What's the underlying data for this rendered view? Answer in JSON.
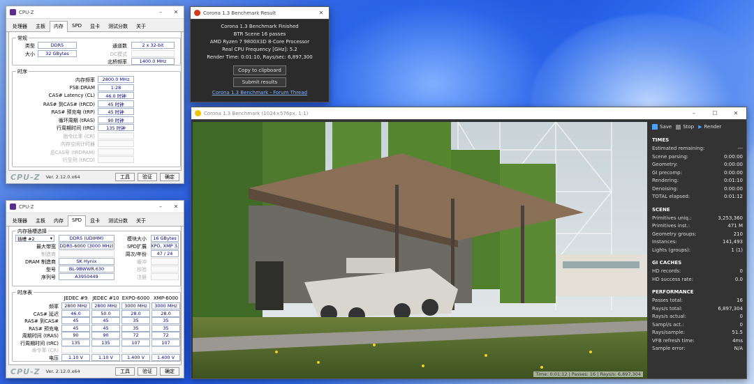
{
  "cpuz1": {
    "title": "CPU-Z",
    "tabs": [
      "处理器",
      "主板",
      "内存",
      "SPD",
      "显卡",
      "测试分数",
      "关于"
    ],
    "active_tab": 2,
    "general": {
      "title": "常规",
      "type_label": "类型",
      "type": "DDR5",
      "size_label": "大小",
      "size": "32 GBytes",
      "channels_label": "通道数",
      "channels": "2 x 32-bit",
      "dc_label": "DC模式",
      "dc": "",
      "nb_label": "北桥频率",
      "nb": "1400.0 MHz"
    },
    "timings": {
      "title": "时序",
      "rows": [
        {
          "label": "内存频率",
          "value": "2800.0 MHz",
          "dis": false
        },
        {
          "label": "FSB:DRAM",
          "value": "1:28",
          "dis": false
        },
        {
          "label": "CAS# Latency (CL)",
          "value": "46.0 时钟",
          "dis": false
        },
        {
          "label": "RAS# 到CAS# (tRCD)",
          "value": "45 时钟",
          "dis": false
        },
        {
          "label": "RAS# 预充电 (tRP)",
          "value": "45 时钟",
          "dis": false
        },
        {
          "label": "循环周期 (tRAS)",
          "value": "90 时钟",
          "dis": false
        },
        {
          "label": "行周期时间 (tRC)",
          "value": "135 时钟",
          "dis": false
        },
        {
          "label": "指令比率 (CR)",
          "value": "",
          "dis": true
        },
        {
          "label": "内存空闲计时器",
          "value": "",
          "dis": true
        },
        {
          "label": "总CAS号 (tRDRAM)",
          "value": "",
          "dis": true
        },
        {
          "label": "行至列 (tRCD)",
          "value": "",
          "dis": true
        }
      ]
    },
    "footer": {
      "logo": "CPU-Z",
      "version": "Ver. 2.12.0.x64",
      "tools": "工具",
      "validate": "验证",
      "ok": "确定"
    }
  },
  "cpuz2": {
    "title": "CPU-Z",
    "tabs": [
      "处理器",
      "主板",
      "内存",
      "SPD",
      "显卡",
      "测试分数",
      "关于"
    ],
    "active_tab": 3,
    "slot": {
      "title": "内存插槽选择",
      "slot": "插槽 #2",
      "type": "DDR5 (UDIMM)",
      "module_size_label": "模块大小",
      "module_size": "16 GBytes",
      "max_bw_label": "最大带宽",
      "max_bw": "DDR5-6000 (3000 MHz)",
      "spd_ext_label": "SPD扩展",
      "spd_ext": "EXPO, XMP 3.0",
      "mfr_label": "制造商",
      "mfr": "",
      "week_label": "周次/年份",
      "week": "47 / 24",
      "dram_label": "DRAM 制造商",
      "dram": "SK Hynix",
      "buffered_label": "缓冲",
      "buffered": "",
      "part_label": "型号",
      "part": "BL-9BWWR.630",
      "correction_label": "校验",
      "correction": "",
      "serial_label": "序列号",
      "serial": "A3950449",
      "registered_label": "注册",
      "registered": ""
    },
    "table": {
      "title": "时序表",
      "headers": [
        "JEDEC #9",
        "JEDEC #10",
        "EXPO-6000",
        "XMP-6000"
      ],
      "rows": [
        {
          "label": "频率",
          "values": [
            "2800 MHz",
            "2800 MHz",
            "3000 MHz",
            "3000 MHz"
          ],
          "dis": false
        },
        {
          "label": "CAS# 延迟",
          "values": [
            "46.0",
            "50.0",
            "28.0",
            "28.0"
          ],
          "dis": false
        },
        {
          "label": "RAS# 到CAS#",
          "values": [
            "45",
            "45",
            "35",
            "35"
          ],
          "dis": false
        },
        {
          "label": "RAS# 预充电",
          "values": [
            "45",
            "45",
            "35",
            "35"
          ],
          "dis": false
        },
        {
          "label": "周期时间 (tRAS)",
          "values": [
            "90",
            "90",
            "72",
            "72"
          ],
          "dis": false
        },
        {
          "label": "行周期时间 (tRC)",
          "values": [
            "135",
            "135",
            "107",
            "107"
          ],
          "dis": false
        },
        {
          "label": "命令率 (CR)",
          "values": [
            "",
            "",
            "",
            ""
          ],
          "dis": true
        },
        {
          "label": "电压",
          "values": [
            "1.10 V",
            "1.10 V",
            "1.400 V",
            "1.400 V"
          ],
          "dis": false
        }
      ]
    },
    "footer": {
      "logo": "CPU-Z",
      "version": "Ver. 2.12.0.x64",
      "tools": "工具",
      "validate": "验证",
      "ok": "确定"
    }
  },
  "result": {
    "title": "Corona 1.3 Benchmark Result",
    "lines": [
      "Corona 1.3 Benchmark Finished",
      "BTR Scene 16 passes",
      "AMD Ryzen 7 9800X3D 8-Core Processor",
      "Real CPU Frequency [GHz]: 5.2",
      "Render Time: 0:01:10, Rays/sec: 6,897,300"
    ],
    "copy": "Copy to clipboard",
    "submit": "Submit results",
    "link": "Corona 1.3 Benchmark - Forum Thread"
  },
  "bench": {
    "title": "Corona 1.3 Benchmark (1024×576px, 1:1)",
    "toolbar": {
      "save": "Save",
      "stop": "Stop",
      "render": "Render"
    },
    "status": "Time: 0:01:12 | Passes: 16 | Rays/s: 6,897,304",
    "sections": [
      {
        "title": "TIMES",
        "rows": [
          [
            "Estimated remaining:",
            "---"
          ],
          [
            "Scene parsing:",
            "0:00:00"
          ],
          [
            "Geometry:",
            "0:00:00"
          ],
          [
            "GI precomp:",
            "0:00:00"
          ],
          [
            "Rendering:",
            "0:01:10"
          ],
          [
            "Denoising:",
            "0:00:00"
          ],
          [
            "TOTAL elapsed:",
            "0:01:12"
          ]
        ]
      },
      {
        "title": "SCENE",
        "rows": [
          [
            "Primitives uniq.:",
            "3,253,360"
          ],
          [
            "Primitives inst.:",
            "471 M"
          ],
          [
            "Geometry groups:",
            "210"
          ],
          [
            "Instances:",
            "141,493"
          ],
          [
            "Lights (groups):",
            "1 (1)"
          ]
        ]
      },
      {
        "title": "GI CACHES",
        "rows": [
          [
            "HD records:",
            "0"
          ],
          [
            "HD success rate:",
            "0.0"
          ]
        ]
      },
      {
        "title": "PERFORMANCE",
        "rows": [
          [
            "Passes total:",
            "16"
          ],
          [
            "Rays/s total:",
            "6,897,304"
          ],
          [
            "Rays/s actual:",
            "0"
          ],
          [
            "Sampl/s act.:",
            "0"
          ],
          [
            "Rays/sample:",
            "51.5"
          ],
          [
            "VFB refresh time:",
            "4ms"
          ],
          [
            "Sample error:",
            "N/A"
          ]
        ]
      }
    ]
  }
}
